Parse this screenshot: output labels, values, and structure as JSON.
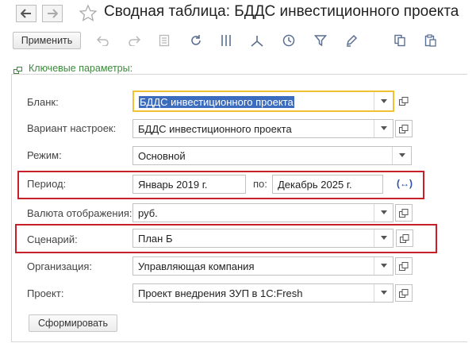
{
  "window": {
    "title": "Сводная таблица: БДДС инвестиционного проекта"
  },
  "toolbar": {
    "apply_label": "Применить",
    "icons": [
      "undo-icon",
      "redo-icon",
      "report-icon",
      "refresh-icon",
      "columns-icon",
      "tree-icon",
      "clock-icon",
      "filter-icon",
      "pencil-icon",
      "copy-icon",
      "paste-icon"
    ]
  },
  "group": {
    "title": "Ключевые параметры:"
  },
  "form": {
    "blank": {
      "label": "Бланк:",
      "value": "БДДС инвестиционного проекта"
    },
    "variant": {
      "label": "Вариант настроек:",
      "value": "БДДС инвестиционного проекта"
    },
    "mode": {
      "label": "Режим:",
      "value": "Основной"
    },
    "period": {
      "label": "Период:",
      "from": "Январь 2019 г.",
      "to_label": "по:",
      "to": "Декабрь 2025 г.",
      "expand_glyph": "(↔)"
    },
    "currency": {
      "label": "Валюта отображения:",
      "value": "руб."
    },
    "scenario": {
      "label": "Сценарий:",
      "value": "План Б"
    },
    "organization": {
      "label": "Организация:",
      "value": "Управляющая компания"
    },
    "project": {
      "label": "Проект:",
      "value": "Проект внедрения ЗУП в 1С:Fresh"
    },
    "submit_label": "Сформировать"
  },
  "colors": {
    "highlight": "#c8202a",
    "group_title": "#3b8a3b",
    "focus_border": "#f0c232",
    "selection": "#3c6cbd"
  }
}
